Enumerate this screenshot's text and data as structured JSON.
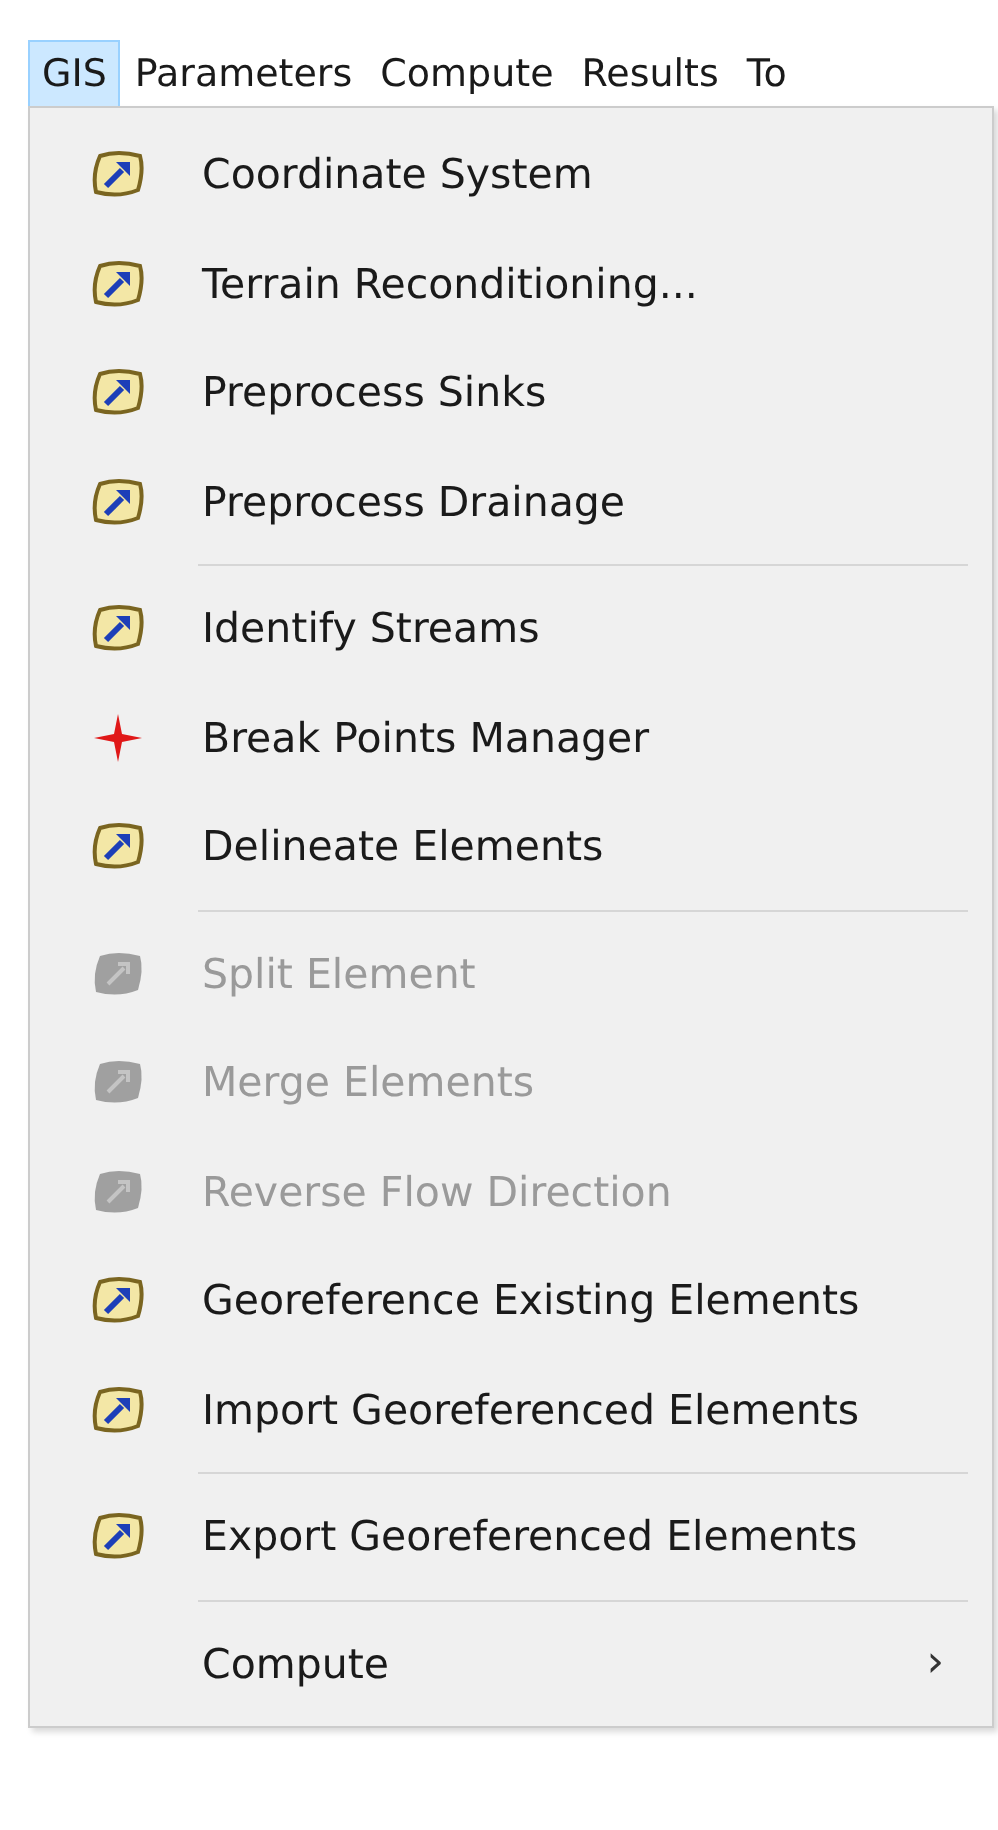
{
  "menubar": [
    {
      "label": "GIS",
      "selected": true
    },
    {
      "label": "Parameters",
      "selected": false
    },
    {
      "label": "Compute",
      "selected": false
    },
    {
      "label": "Results",
      "selected": false
    },
    {
      "label": "To",
      "selected": false
    }
  ],
  "menu": {
    "groups": [
      {
        "items": [
          {
            "kind": "tool",
            "label": "Coordinate System",
            "disabled": false
          },
          {
            "kind": "tool",
            "label": "Terrain Reconditioning...",
            "disabled": false
          },
          {
            "kind": "tool",
            "label": "Preprocess Sinks",
            "disabled": false
          },
          {
            "kind": "tool",
            "label": "Preprocess Drainage",
            "disabled": false
          }
        ]
      },
      {
        "items": [
          {
            "kind": "tool",
            "label": "Identify Streams",
            "disabled": false
          },
          {
            "kind": "point",
            "label": "Break Points Manager",
            "disabled": false
          },
          {
            "kind": "tool",
            "label": "Delineate Elements",
            "disabled": false
          }
        ]
      },
      {
        "items": [
          {
            "kind": "tool",
            "label": "Split Element",
            "disabled": true
          },
          {
            "kind": "tool",
            "label": "Merge Elements",
            "disabled": true
          },
          {
            "kind": "tool",
            "label": "Reverse Flow Direction",
            "disabled": true
          },
          {
            "kind": "tool",
            "label": "Georeference Existing Elements",
            "disabled": false
          },
          {
            "kind": "tool",
            "label": "Import Georeferenced Elements",
            "disabled": false
          }
        ]
      },
      {
        "items": [
          {
            "kind": "tool",
            "label": "Export Georeferenced Elements",
            "disabled": false
          }
        ]
      },
      {
        "items": [
          {
            "kind": "submenu",
            "label": "Compute",
            "disabled": false,
            "arrow": "›"
          }
        ]
      }
    ]
  }
}
